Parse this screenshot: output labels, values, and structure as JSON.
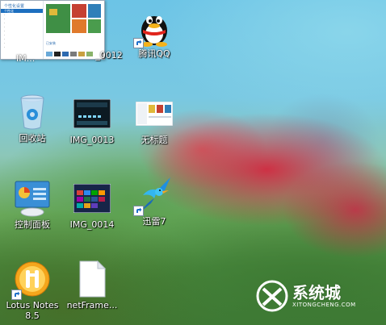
{
  "desktop": {
    "icons": [
      {
        "label": "IMG_0012",
        "shown_partial": "_0012"
      },
      {
        "label": "腾讯QQ"
      },
      {
        "label": "回收站"
      },
      {
        "label": "IMG_0013"
      },
      {
        "label": "无标题"
      },
      {
        "label": "控制面板"
      },
      {
        "label": "IMG_0014"
      },
      {
        "label": "迅雷7"
      },
      {
        "label": "Lotus Notes 8.5",
        "line1": "Lotus Notes",
        "line2": "8.5"
      },
      {
        "label": "netFrame..."
      }
    ],
    "thumbnail": {
      "title": "个性化设置",
      "menu_items": [
        "个性化",
        "",
        "",
        "",
        "",
        "",
        "",
        "",
        "",
        "",
        "",
        ""
      ],
      "caption": "已安装"
    },
    "partial_label_under_thumb": "IM..."
  },
  "watermark": {
    "brand": "系统城",
    "domain": "XITONGCHENG.COM"
  },
  "colors": {
    "sky": "#6cc4e6",
    "flower": "#d4243c",
    "leaves": "#4a8a3e",
    "label_text": "#ffffff",
    "selection_blue": "#1d6fbf"
  }
}
